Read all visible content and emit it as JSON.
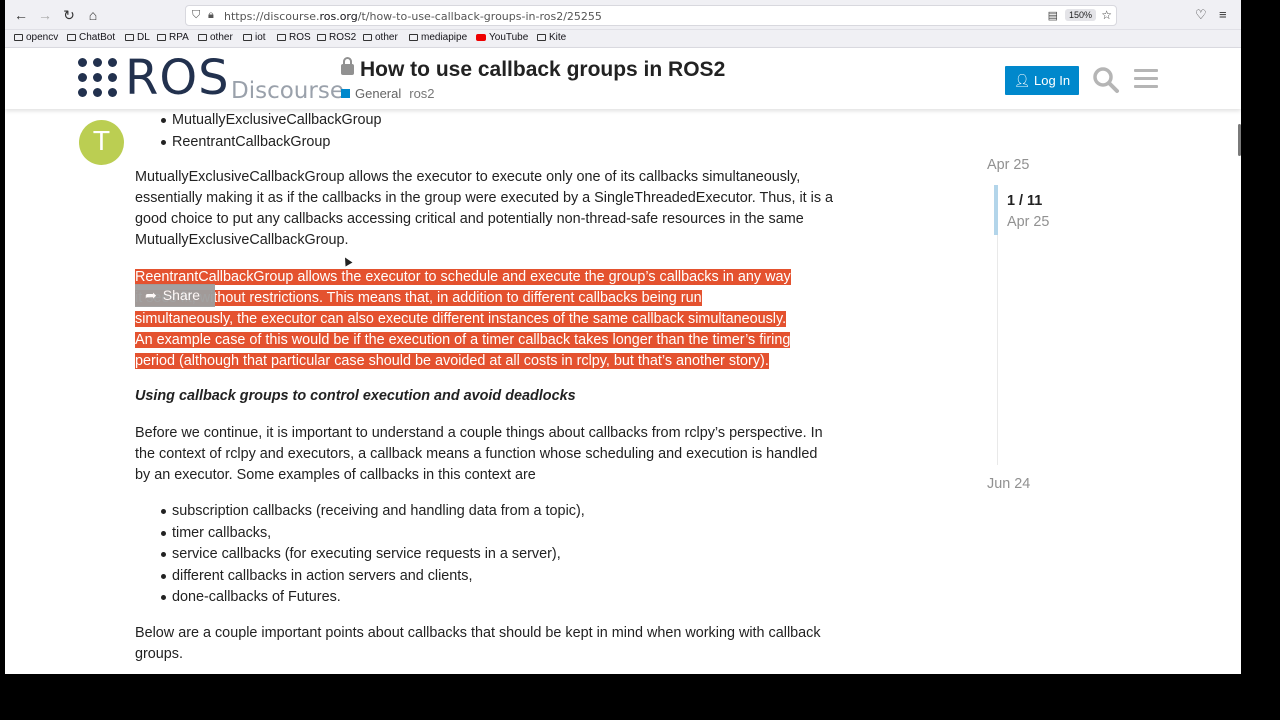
{
  "browser": {
    "url_prefix": "https://discourse.",
    "url_host": "ros.org",
    "url_path": "/t/how-to-use-callback-groups-in-ros2/25255",
    "zoom": "150%",
    "bookmarks": [
      {
        "label": "opencv",
        "type": "folder"
      },
      {
        "label": "ChatBot",
        "type": "folder"
      },
      {
        "label": "DL",
        "type": "folder"
      },
      {
        "label": "RPA",
        "type": "folder"
      },
      {
        "label": "other",
        "type": "folder"
      },
      {
        "label": "iot",
        "type": "folder"
      },
      {
        "label": "ROS",
        "type": "folder"
      },
      {
        "label": "ROS2",
        "type": "folder"
      },
      {
        "label": "other",
        "type": "folder"
      },
      {
        "label": "mediapipe",
        "type": "folder"
      },
      {
        "label": "YouTube",
        "type": "youtube"
      },
      {
        "label": "Kite",
        "type": "folder"
      }
    ]
  },
  "header": {
    "logo_ros": "ROS",
    "logo_discourse": "Discourse",
    "title": "How to use callback groups in ROS2",
    "category": "General",
    "tag": "ros2",
    "login_label": "Log In",
    "brand_color": "#22314e",
    "accent_color": "#0088cc"
  },
  "post": {
    "avatar_letter": "T",
    "avatar_color": "#bbce52",
    "list_top": [
      "MutuallyExclusiveCallbackGroup",
      "ReentrantCallbackGroup"
    ],
    "para_mutex": "MutuallyExclusiveCallbackGroup allows the executor to execute only one of its callbacks simultaneously, essentially making it as if the callbacks in the group were executed by a SingleThreadedExecutor. Thus, it is a good choice to put any callbacks accessing critical and potentially non-thread-safe resources in the same MutuallyExclusiveCallbackGroup.",
    "highlight_lines": [
      "ReentrantCallbackGroup allows the executor to schedule and execute the group’s callbacks in any way",
      "it sees fit, without restrictions. This means that, in addition to different callbacks being run",
      "simultaneously, the executor can also execute different instances of the same callback simultaneously.",
      "An example case of this would be if the execution of a timer callback takes longer than the timer’s firing",
      "period (although that particular case should be avoided at all costs in rclpy, but that’s another story)."
    ],
    "highlight_color": "#e4522f",
    "share_label": "Share",
    "heading": "Using callback groups to control execution and avoid deadlocks",
    "para_before": "Before we continue, it is important to understand a couple things about callbacks from rclpy’s perspective. In the context of rclpy and executors, a callback means a function whose scheduling and execution is handled by an executor. Some examples of callbacks in this context are",
    "list_examples": [
      "subscription callbacks (receiving and handling data from a topic),",
      "timer callbacks,",
      "service callbacks (for executing service requests in a server),",
      "different callbacks in action servers and clients,",
      "done-callbacks of Futures."
    ],
    "para_below": "Below are a couple important points about callbacks that should be kept in mind when working with callback groups."
  },
  "timeline": {
    "date_top": "Apr 25",
    "count": "1 / 11",
    "date_current": "Apr 25",
    "date_bottom": "Jun 24"
  }
}
